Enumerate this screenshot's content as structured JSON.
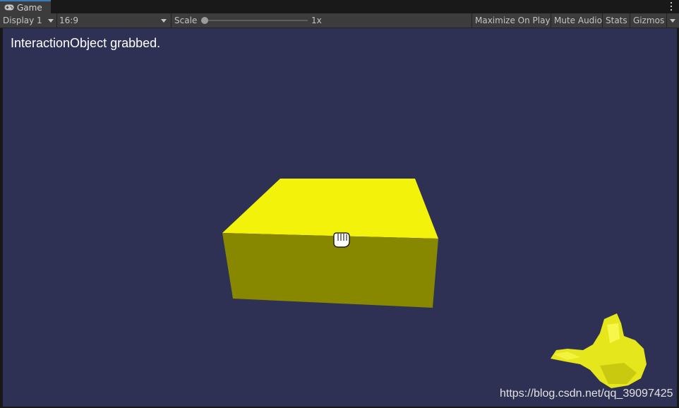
{
  "tab": {
    "label": "Game",
    "icon": "gamepad-icon"
  },
  "toolbar": {
    "display": "Display 1",
    "aspect": "16:9",
    "scale_label": "Scale",
    "scale_value": "1x",
    "scale_level": 0.0,
    "maximize": "Maximize On Play",
    "mute": "Mute Audio",
    "stats": "Stats",
    "gizmos": "Gizmos"
  },
  "game": {
    "status_text": "InteractionObject grabbed.",
    "watermark": "https://blog.csdn.net/qq_39097425",
    "cube_top_color": "#f2f20a",
    "cube_front_color": "#878700",
    "hand_color": "#eded1e",
    "background_color": "#2e3154",
    "cursor_icon": "grab-hand-cursor-icon"
  }
}
